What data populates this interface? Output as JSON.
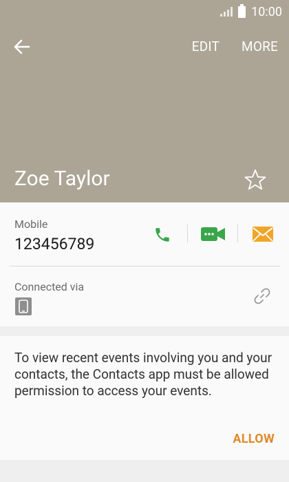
{
  "status_bar": {
    "time": "10:00"
  },
  "header": {
    "edit_label": "EDIT",
    "more_label": "MORE",
    "contact_name": "Zoe Taylor",
    "background_color": "#aca595"
  },
  "phone": {
    "label": "Mobile",
    "number": "123456789",
    "icons": [
      "phone-icon",
      "video-call-icon",
      "email-icon"
    ],
    "colors": {
      "phone": "#3aa64a",
      "video": "#3aa64a",
      "email": "#f0a52a"
    }
  },
  "connection": {
    "label": "Connected via",
    "icons": [
      "device-icon",
      "link-icon"
    ]
  },
  "permission": {
    "message": "To view recent events involving you and your contacts, the Contacts app must be allowed permission to access your events.",
    "allow_label": "ALLOW",
    "accent_color": "#e08a2b"
  }
}
